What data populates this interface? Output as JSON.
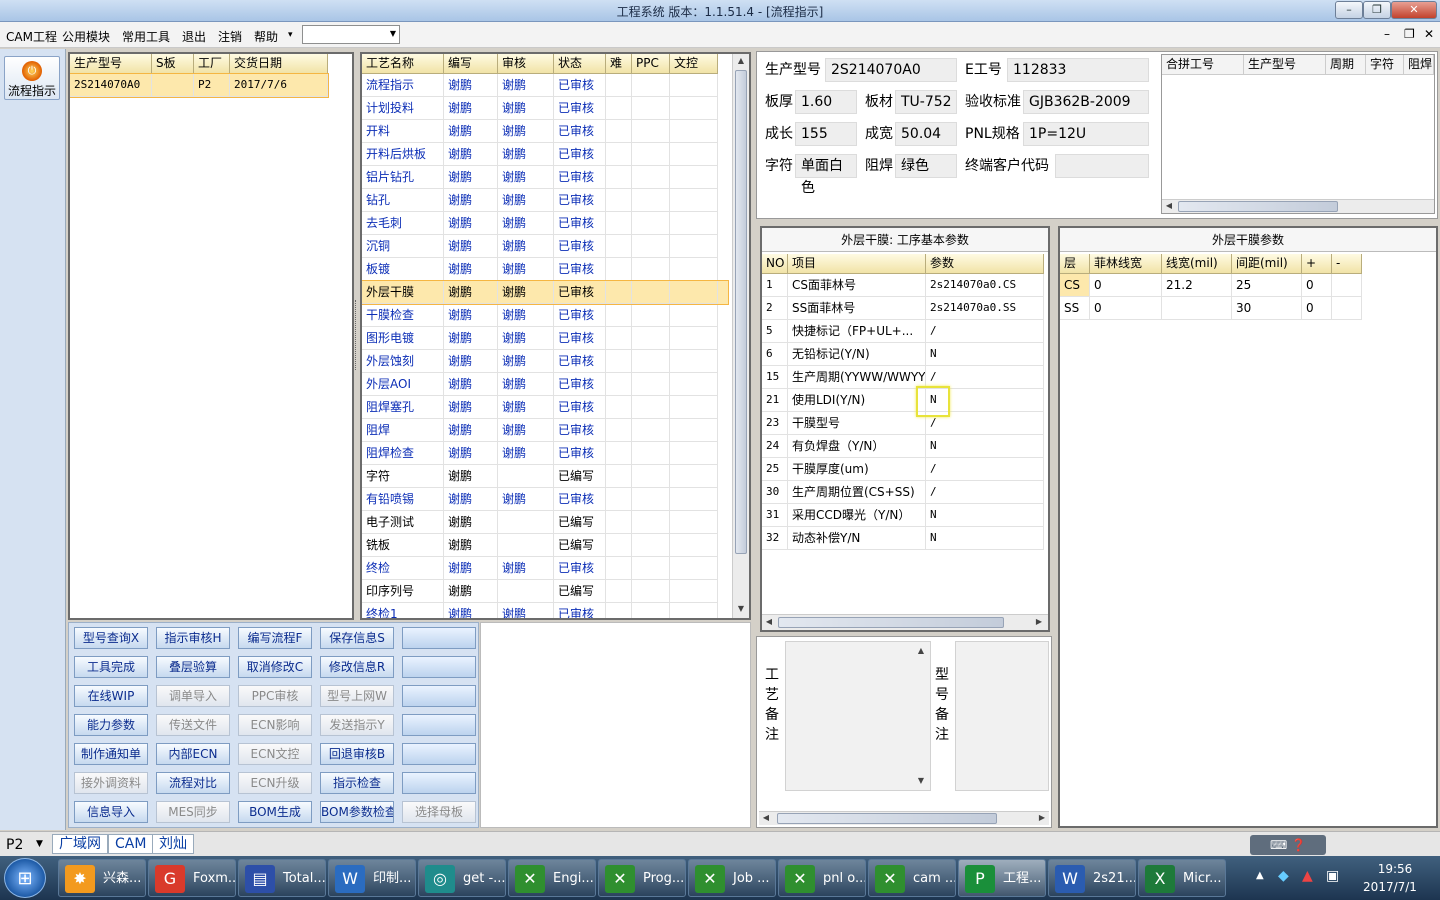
{
  "window": {
    "title": "工程系统   版本：1.1.51.4 - [流程指示]"
  },
  "menu": {
    "items": [
      "CAM工程",
      "公用模块",
      "常用工具",
      "退出",
      "注销",
      "帮助"
    ],
    "help_arrow": "▾"
  },
  "left_nav": {
    "flow_button": "流程指示"
  },
  "orders": {
    "columns": [
      "生产型号",
      "S板",
      "工厂",
      "交货日期"
    ],
    "rows": [
      {
        "model": "2S214070A0",
        "s": "",
        "factory": "P2",
        "date": "2017/7/6"
      }
    ]
  },
  "process": {
    "columns": [
      "工艺名称",
      "编写",
      "审核",
      "状态",
      "难",
      "PPC",
      "文控"
    ],
    "rows": [
      {
        "name": "流程指示",
        "writer": "谢鹏",
        "auditor": "谢鹏",
        "status": "已审核"
      },
      {
        "name": "计划投料",
        "writer": "谢鹏",
        "auditor": "谢鹏",
        "status": "已审核"
      },
      {
        "name": "开料",
        "writer": "谢鹏",
        "auditor": "谢鹏",
        "status": "已审核"
      },
      {
        "name": "开料后烘板",
        "writer": "谢鹏",
        "auditor": "谢鹏",
        "status": "已审核"
      },
      {
        "name": "铝片钻孔",
        "writer": "谢鹏",
        "auditor": "谢鹏",
        "status": "已审核"
      },
      {
        "name": "钻孔",
        "writer": "谢鹏",
        "auditor": "谢鹏",
        "status": "已审核"
      },
      {
        "name": "去毛刺",
        "writer": "谢鹏",
        "auditor": "谢鹏",
        "status": "已审核"
      },
      {
        "name": "沉铜",
        "writer": "谢鹏",
        "auditor": "谢鹏",
        "status": "已审核"
      },
      {
        "name": "板镀",
        "writer": "谢鹏",
        "auditor": "谢鹏",
        "status": "已审核"
      },
      {
        "name": "外层干膜",
        "writer": "谢鹏",
        "auditor": "谢鹏",
        "status": "已审核"
      },
      {
        "name": "干膜检查",
        "writer": "谢鹏",
        "auditor": "谢鹏",
        "status": "已审核"
      },
      {
        "name": "图形电镀",
        "writer": "谢鹏",
        "auditor": "谢鹏",
        "status": "已审核"
      },
      {
        "name": "外层蚀刻",
        "writer": "谢鹏",
        "auditor": "谢鹏",
        "status": "已审核"
      },
      {
        "name": "外层AOI",
        "writer": "谢鹏",
        "auditor": "谢鹏",
        "status": "已审核"
      },
      {
        "name": "阻焊塞孔",
        "writer": "谢鹏",
        "auditor": "谢鹏",
        "status": "已审核"
      },
      {
        "name": "阻焊",
        "writer": "谢鹏",
        "auditor": "谢鹏",
        "status": "已审核"
      },
      {
        "name": "阻焊检查",
        "writer": "谢鹏",
        "auditor": "谢鹏",
        "status": "已审核"
      },
      {
        "name": "字符",
        "writer": "谢鹏",
        "auditor": "",
        "status": "已编写"
      },
      {
        "name": "有铅喷锡",
        "writer": "谢鹏",
        "auditor": "谢鹏",
        "status": "已审核"
      },
      {
        "name": "电子测试",
        "writer": "谢鹏",
        "auditor": "",
        "status": "已编写"
      },
      {
        "name": "铣板",
        "writer": "谢鹏",
        "auditor": "",
        "status": "已编写"
      },
      {
        "name": "终检",
        "writer": "谢鹏",
        "auditor": "谢鹏",
        "status": "已审核"
      },
      {
        "name": "印序列号",
        "writer": "谢鹏",
        "auditor": "",
        "status": "已编写"
      },
      {
        "name": "终检1",
        "writer": "谢鹏",
        "auditor": "谢鹏",
        "status": "已审核"
      }
    ],
    "selected_index": 9
  },
  "buttons": [
    [
      "型号查询X",
      "指示审核H",
      "编写流程F",
      "保存信息S",
      ""
    ],
    [
      "工具完成",
      "叠层验算",
      "取消修改C",
      "修改信息R",
      ""
    ],
    [
      "在线WIP",
      "调单导入",
      "PPC审核",
      "型号上网W",
      ""
    ],
    [
      "能力参数",
      "传送文件",
      "ECN影响",
      "发送指示Y",
      ""
    ],
    [
      "制作通知单",
      "内部ECN",
      "ECN文控",
      "回退审核B",
      ""
    ],
    [
      "接外调资料",
      "流程对比",
      "ECN升级",
      "指示检查",
      ""
    ],
    [
      "信息导入",
      "MES同步",
      "BOM生成",
      "BOM参数检查",
      "选择母板"
    ]
  ],
  "buttons_disabled": [
    [
      false,
      false,
      false,
      false,
      false
    ],
    [
      false,
      false,
      false,
      false,
      false
    ],
    [
      false,
      true,
      true,
      true,
      false
    ],
    [
      false,
      true,
      true,
      true,
      false
    ],
    [
      false,
      false,
      true,
      false,
      false
    ],
    [
      true,
      false,
      true,
      false,
      false
    ],
    [
      false,
      true,
      false,
      false,
      true
    ]
  ],
  "info": {
    "model_label": "生产型号",
    "model": "2S214070A0",
    "eno_label": "E工号",
    "eno": "112833",
    "thickness_label": "板厚",
    "thickness": "1.60",
    "material_label": "板材",
    "material": "TU-752",
    "standard_label": "验收标准",
    "standard": "GJB362B-2009",
    "length_label": "成长",
    "length": "155",
    "width_label": "成宽",
    "width": "50.04",
    "pnl_label": "PNL规格",
    "pnl": "1P=12U",
    "char_label": "字符",
    "char": "单面白色",
    "mask_label": "阻焊",
    "mask": "绿色",
    "customer_label": "终端客户代码",
    "customer": ""
  },
  "merge": {
    "columns": [
      "合拼工号",
      "生产型号",
      "周期",
      "字符",
      "阻焊"
    ]
  },
  "params": {
    "title": "外层干膜: 工序基本参数",
    "columns": [
      "NO",
      "项目",
      "参数"
    ],
    "rows": [
      {
        "no": "1",
        "item": "CS面菲林号",
        "value": "2s214070a0.CS"
      },
      {
        "no": "2",
        "item": "SS面菲林号",
        "value": "2s214070a0.SS"
      },
      {
        "no": "5",
        "item": "快捷标记（FP+UL+...",
        "value": "/"
      },
      {
        "no": "6",
        "item": "无铅标记(Y/N)",
        "value": "N"
      },
      {
        "no": "15",
        "item": "生产周期(YYWW/WWYY)",
        "value": "/"
      },
      {
        "no": "21",
        "item": "使用LDI(Y/N)",
        "value": "N"
      },
      {
        "no": "23",
        "item": "干膜型号",
        "value": "/"
      },
      {
        "no": "24",
        "item": "有负焊盘（Y/N）",
        "value": "N"
      },
      {
        "no": "25",
        "item": "干膜厚度(um)",
        "value": "/"
      },
      {
        "no": "30",
        "item": "生产周期位置(CS+SS)",
        "value": "/"
      },
      {
        "no": "31",
        "item": "采用CCD曝光（Y/N）",
        "value": "N"
      },
      {
        "no": "32",
        "item": "动态补偿Y/N",
        "value": "N"
      }
    ]
  },
  "film": {
    "title": "外层干膜参数",
    "columns": [
      "层",
      "菲林线宽",
      "线宽(mil)",
      "间距(mil)",
      "+",
      "-"
    ],
    "rows": [
      {
        "layer": "CS",
        "fw": "0",
        "lw": "21.2",
        "sp": "25",
        "plus": "0",
        "minus": ""
      },
      {
        "layer": "SS",
        "fw": "0",
        "lw": "",
        "sp": "30",
        "plus": "0",
        "minus": ""
      }
    ]
  },
  "notes": {
    "process_label": [
      "工",
      "艺",
      "备",
      "注"
    ],
    "model_label": [
      "型",
      "号",
      "备",
      "注"
    ]
  },
  "statusbar": {
    "factory": "P2",
    "net": "广域网",
    "dept": "CAM",
    "user": "刘灿"
  },
  "taskbar": {
    "items": [
      "兴森...",
      "Foxm...",
      "Total...",
      "印制...",
      "get -...",
      "Engi...",
      "Prog...",
      "Job ...",
      "pnl o...",
      "cam ...",
      "工程...",
      "2s21...",
      "Micr..."
    ],
    "time": "19:56",
    "date": "2017/7/1"
  }
}
